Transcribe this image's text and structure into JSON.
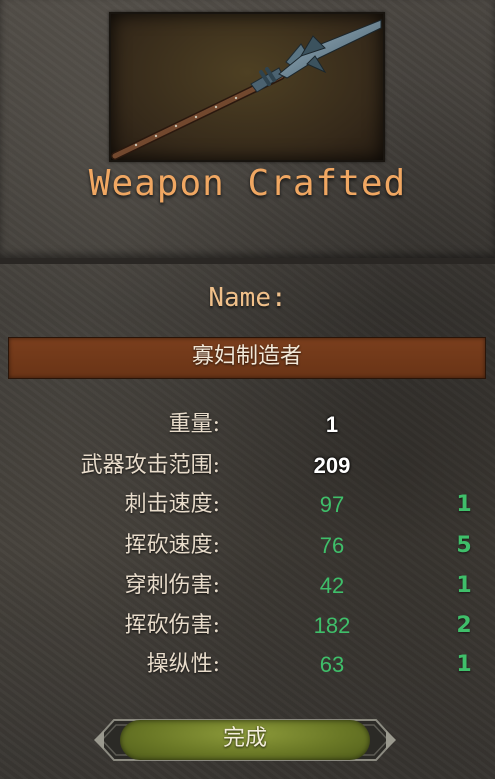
{
  "dialog": {
    "title": "Weapon Crafted",
    "name_label": "Name:",
    "weapon_name": "寡妇制造者",
    "weapon_icon": "spear-icon"
  },
  "stats": [
    {
      "label": "重量:",
      "value": "1",
      "extra": "",
      "style": "white"
    },
    {
      "label": "武器攻击范围:",
      "value": "209",
      "extra": "",
      "style": "white"
    },
    {
      "label": "刺击速度:",
      "value": "97",
      "extra": "1",
      "style": "green"
    },
    {
      "label": "挥砍速度:",
      "value": "76",
      "extra": "5",
      "style": "green"
    },
    {
      "label": "穿刺伤害:",
      "value": "42",
      "extra": "1",
      "style": "green"
    },
    {
      "label": "挥砍伤害:",
      "value": "182",
      "extra": "2",
      "style": "green"
    },
    {
      "label": "操纵性:",
      "value": "63",
      "extra": "1",
      "style": "green"
    }
  ],
  "done_button": {
    "label": "完成"
  },
  "colors": {
    "title": "#f0a762",
    "stat_green": "#3fbf6a",
    "name_field": "#7a3e1d",
    "button": "#6a7826"
  }
}
